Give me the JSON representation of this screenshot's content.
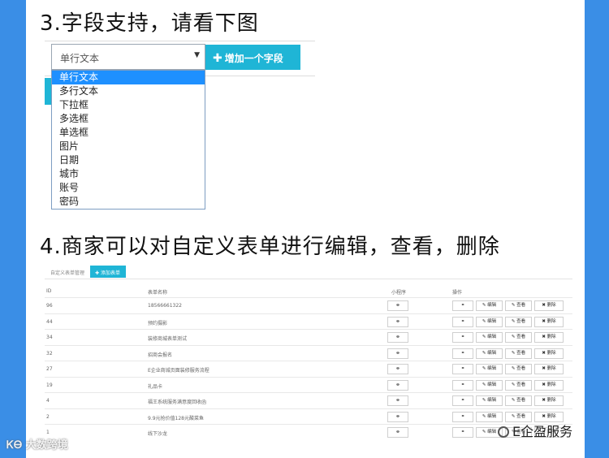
{
  "heading3": "3.字段支持，请看下图",
  "heading4": "4.商家可以对自定义表单进行编辑，查看，删除",
  "field_demo": {
    "selected_value": "单行文本",
    "add_button_label": "增加一个字段",
    "options": [
      "单行文本",
      "多行文本",
      "下拉框",
      "多选框",
      "单选框",
      "图片",
      "日期",
      "城市",
      "账号",
      "密码"
    ]
  },
  "form_table": {
    "breadcrumb": "自定义表单管理",
    "add_button_label": "添加表单",
    "columns": [
      "ID",
      "表单名称",
      "小程序",
      "操作"
    ],
    "actions": {
      "edit": "编辑",
      "view": "查看",
      "delete": "删除"
    },
    "rows": [
      {
        "id": "96",
        "name": "18566661322"
      },
      {
        "id": "44",
        "name": "预约摄影"
      },
      {
        "id": "34",
        "name": "装修商城表单测试"
      },
      {
        "id": "32",
        "name": "招商会报名"
      },
      {
        "id": "27",
        "name": "E企业商城页面装修服务流程"
      },
      {
        "id": "19",
        "name": "礼品卡"
      },
      {
        "id": "4",
        "name": "福王系统服务满意度回收函"
      },
      {
        "id": "2",
        "name": "9.9元抢价值128元酸菜鱼"
      },
      {
        "id": "1",
        "name": "线下沙龙"
      }
    ]
  },
  "watermarks": {
    "left": "大数跨境",
    "right": "E企盈服务"
  }
}
